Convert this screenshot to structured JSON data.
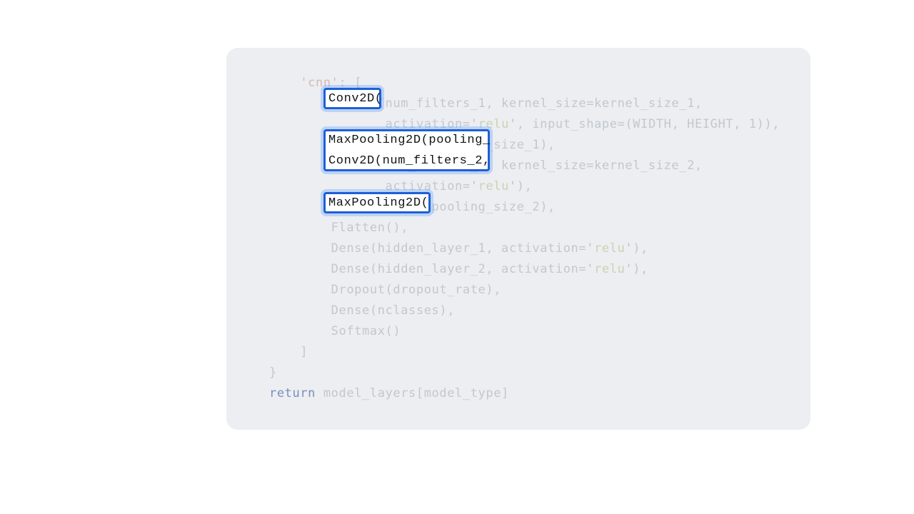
{
  "code": {
    "lines": [
      {
        "segments": [
          {
            "text": "    ",
            "cls": ""
          },
          {
            "text": "'cnn'",
            "cls": "str"
          },
          {
            "text": ": [",
            "cls": ""
          }
        ]
      },
      {
        "segments": [
          {
            "text": "        Conv2D(num_filters_1, kernel_size=kernel_size_1,",
            "cls": ""
          }
        ]
      },
      {
        "segments": [
          {
            "text": "               activation=",
            "cls": ""
          },
          {
            "text": "'",
            "cls": "strlit"
          },
          {
            "text": "relu",
            "cls": "accent"
          },
          {
            "text": "'",
            "cls": "strlit"
          },
          {
            "text": ", input_shape=(WIDTH, HEIGHT, 1)),",
            "cls": ""
          }
        ]
      },
      {
        "segments": [
          {
            "text": "        MaxPooling2D(pooling_size_1),",
            "cls": ""
          }
        ]
      },
      {
        "segments": [
          {
            "text": "        Conv2D(num_filters_2, kernel_size=kernel_size_2,",
            "cls": ""
          }
        ]
      },
      {
        "segments": [
          {
            "text": "               activation=",
            "cls": ""
          },
          {
            "text": "'",
            "cls": "strlit"
          },
          {
            "text": "relu",
            "cls": "accent"
          },
          {
            "text": "'",
            "cls": "strlit"
          },
          {
            "text": "),",
            "cls": ""
          }
        ]
      },
      {
        "segments": [
          {
            "text": "        MaxPooling2D(pooling_size_2),",
            "cls": ""
          }
        ]
      },
      {
        "segments": [
          {
            "text": "        Flatten(),",
            "cls": ""
          }
        ]
      },
      {
        "segments": [
          {
            "text": "        Dense(hidden_layer_1, activation=",
            "cls": ""
          },
          {
            "text": "'",
            "cls": "strlit"
          },
          {
            "text": "relu",
            "cls": "accent"
          },
          {
            "text": "'",
            "cls": "strlit"
          },
          {
            "text": "),",
            "cls": ""
          }
        ]
      },
      {
        "segments": [
          {
            "text": "        Dense(hidden_layer_2, activation=",
            "cls": ""
          },
          {
            "text": "'",
            "cls": "strlit"
          },
          {
            "text": "relu",
            "cls": "accent"
          },
          {
            "text": "'",
            "cls": "strlit"
          },
          {
            "text": "),",
            "cls": ""
          }
        ]
      },
      {
        "segments": [
          {
            "text": "        Dropout(dropout_rate),",
            "cls": ""
          }
        ]
      },
      {
        "segments": [
          {
            "text": "        Dense(nclasses),",
            "cls": ""
          }
        ]
      },
      {
        "segments": [
          {
            "text": "        Softmax()",
            "cls": ""
          }
        ]
      },
      {
        "segments": [
          {
            "text": "    ]",
            "cls": ""
          }
        ]
      },
      {
        "segments": [
          {
            "text": "}",
            "cls": ""
          }
        ]
      },
      {
        "segments": [
          {
            "text": "return",
            "cls": "ret-kw"
          },
          {
            "text": " model_layers[model_type]",
            "cls": ""
          }
        ]
      }
    ]
  },
  "highlights": {
    "hl1": "Conv2D(",
    "hl2_line1": "MaxPooling2D(pooling_",
    "hl2_line2": "Conv2D(num_filters_2,",
    "hl3": "MaxPooling2D("
  }
}
